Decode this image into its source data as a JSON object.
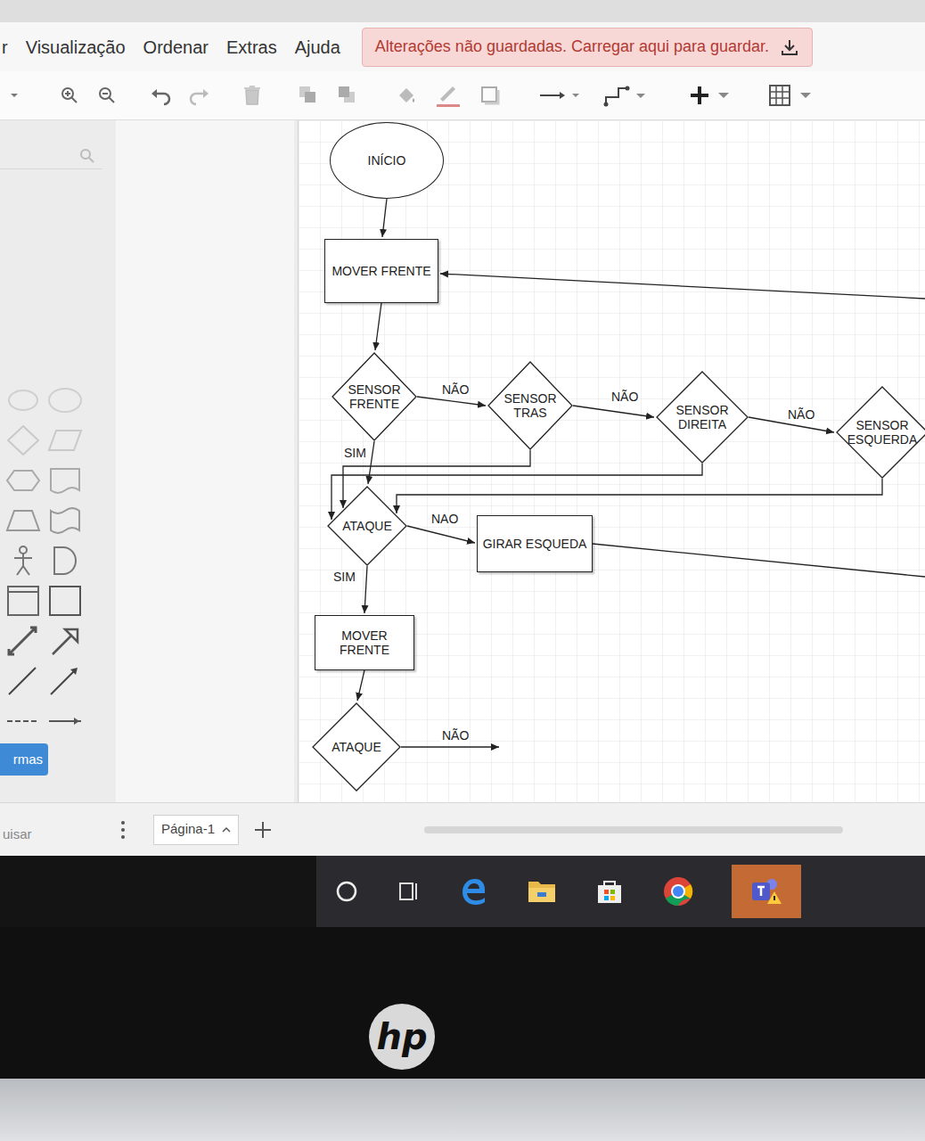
{
  "menu": {
    "items": [
      "r",
      "Visualização",
      "Ordenar",
      "Extras",
      "Ajuda"
    ]
  },
  "banner": {
    "text": "Alterações não guardadas. Carregar aqui para guardar."
  },
  "sidebar": {
    "button": "rmas"
  },
  "diagram": {
    "nodes": [
      {
        "label": "INÍCIO",
        "kind": "ellipse"
      },
      {
        "label": "MOVER FRENTE",
        "kind": "rect"
      },
      {
        "label": "SENSOR FRENTE",
        "kind": "diamond"
      },
      {
        "label": "SENSOR TRAS",
        "kind": "diamond"
      },
      {
        "label": "SENSOR DIREITA",
        "kind": "diamond"
      },
      {
        "label": "SENSOR ESQUERDA",
        "kind": "diamond"
      },
      {
        "label": "ATAQUE",
        "kind": "diamond"
      },
      {
        "label": "GIRAR ESQUEDA",
        "kind": "rect"
      },
      {
        "label": "MOVER FRENTE",
        "kind": "rect"
      },
      {
        "label": "ATAQUE",
        "kind": "diamond"
      }
    ],
    "edge_labels": [
      "NÃO",
      "NÃO",
      "NÃO",
      "SIM",
      "NAO",
      "SIM",
      "NÃO"
    ]
  },
  "pages": {
    "tabs": [
      {
        "label": "Página-1",
        "selected": true
      }
    ]
  },
  "status": {
    "search": "uisar"
  },
  "laptop": {
    "logo": "hp"
  }
}
